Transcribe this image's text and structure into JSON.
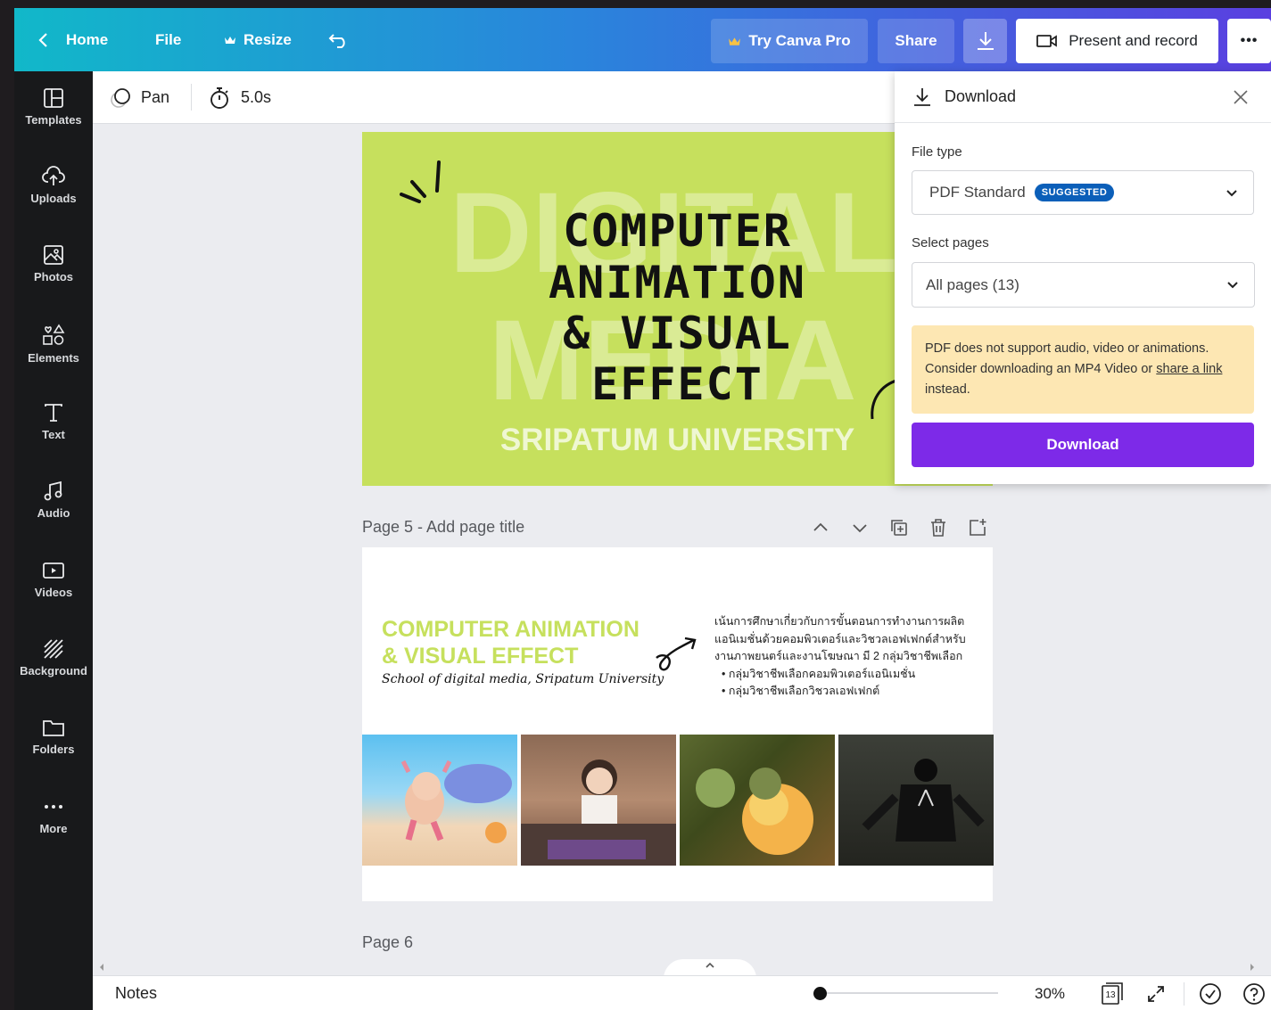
{
  "topbar": {
    "home_label": "Home",
    "file_label": "File",
    "resize_label": "Resize",
    "try_pro_label": "Try Canva Pro",
    "share_label": "Share",
    "present_label": "Present and record",
    "more_label": "•••"
  },
  "sidebar": {
    "items": [
      {
        "label": "Templates"
      },
      {
        "label": "Uploads"
      },
      {
        "label": "Photos"
      },
      {
        "label": "Elements"
      },
      {
        "label": "Text"
      },
      {
        "label": "Audio"
      },
      {
        "label": "Videos"
      },
      {
        "label": "Background"
      },
      {
        "label": "Folders"
      },
      {
        "label": "More"
      }
    ]
  },
  "subbar": {
    "pan_label": "Pan",
    "duration_label": "5.0s"
  },
  "page4": {
    "bg_word_1": "DIGITAL",
    "bg_word_2": "MEDIA",
    "title_line_1": "COMPUTER",
    "title_line_2": "ANIMATION",
    "title_line_3": "& VISUAL",
    "title_line_4": "EFFECT",
    "university": "SRIPATUM UNIVERSITY",
    "color": "#c6e05d"
  },
  "page5": {
    "header_label": "Page 5 - Add page title",
    "title_line_1": "COMPUTER ANIMATION",
    "title_line_2": "& VISUAL EFFECT",
    "subtitle": "School of digital media, Sripatum University",
    "desc_line_1": "เน้นการศึกษาเกี่ยวกับการขั้นตอนการทำงานการผลิต",
    "desc_line_2": "แอนิเมชั่นด้วยคอมพิวเตอร์และวิชวลเอฟเฟกต์สำหรับ",
    "desc_line_3": "งานภาพยนตร์และงานโฆษณา มี 2 กลุ่มวิชาชีพเลือก",
    "bullets": [
      "กลุ่มวิชาชีพเลือกคอมพิวเตอร์แอนิเมชั่น",
      "กลุ่มวิชาชีพเลือกวิชวลเอฟเฟกต์"
    ]
  },
  "page6": {
    "header_label": "Page 6"
  },
  "download_panel": {
    "title": "Download",
    "file_type_label": "File type",
    "file_type_value": "PDF Standard",
    "suggested_badge": "SUGGESTED",
    "select_pages_label": "Select pages",
    "select_pages_value": "All pages (13)",
    "warning_text_1": "PDF does not support audio, video or animations.",
    "warning_text_2": "Consider downloading an MP4 Video or ",
    "warning_link": "share a link",
    "warning_text_3": "instead.",
    "download_button": "Download",
    "accent": "#7d2ae8"
  },
  "bottombar": {
    "notes_label": "Notes",
    "zoom_label": "30%",
    "page_count": "13",
    "zoom_slider_level": 0
  }
}
